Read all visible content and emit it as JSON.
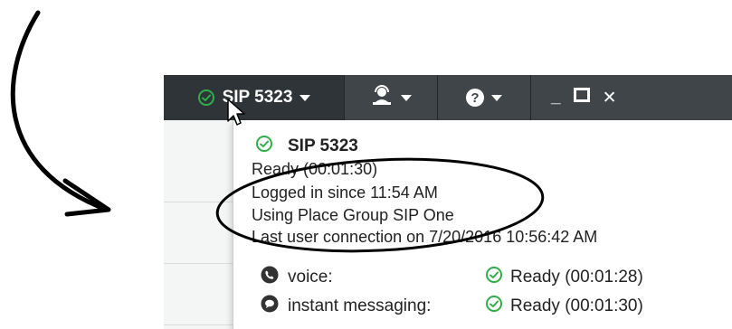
{
  "toolbar": {
    "status_label": "SIP 5323",
    "status_icon": "ready-check-icon",
    "agent_icon": "agent-headset-icon",
    "help_icon": "help-icon",
    "help_glyph": "?",
    "minimize_glyph": "_",
    "close_glyph": "✕"
  },
  "popup": {
    "title": "SIP 5323",
    "ready": "Ready  (00:01:30)",
    "logged_in": "Logged in since 11:54 AM",
    "place_group": "Using Place Group SIP One",
    "last_connection": "Last user connection on 7/20/2016 10:56:42 AM",
    "media": [
      {
        "name": "voice:",
        "icon": "phone-icon",
        "state": "Ready  (00:01:28)"
      },
      {
        "name": "instant messaging:",
        "icon": "chat-bubble-icon",
        "state": "Ready  (00:01:30)"
      }
    ]
  },
  "colors": {
    "toolbar_bg": "#3f4549",
    "status_button_bg": "#2e3437",
    "ready_green": "#2fae4a"
  }
}
